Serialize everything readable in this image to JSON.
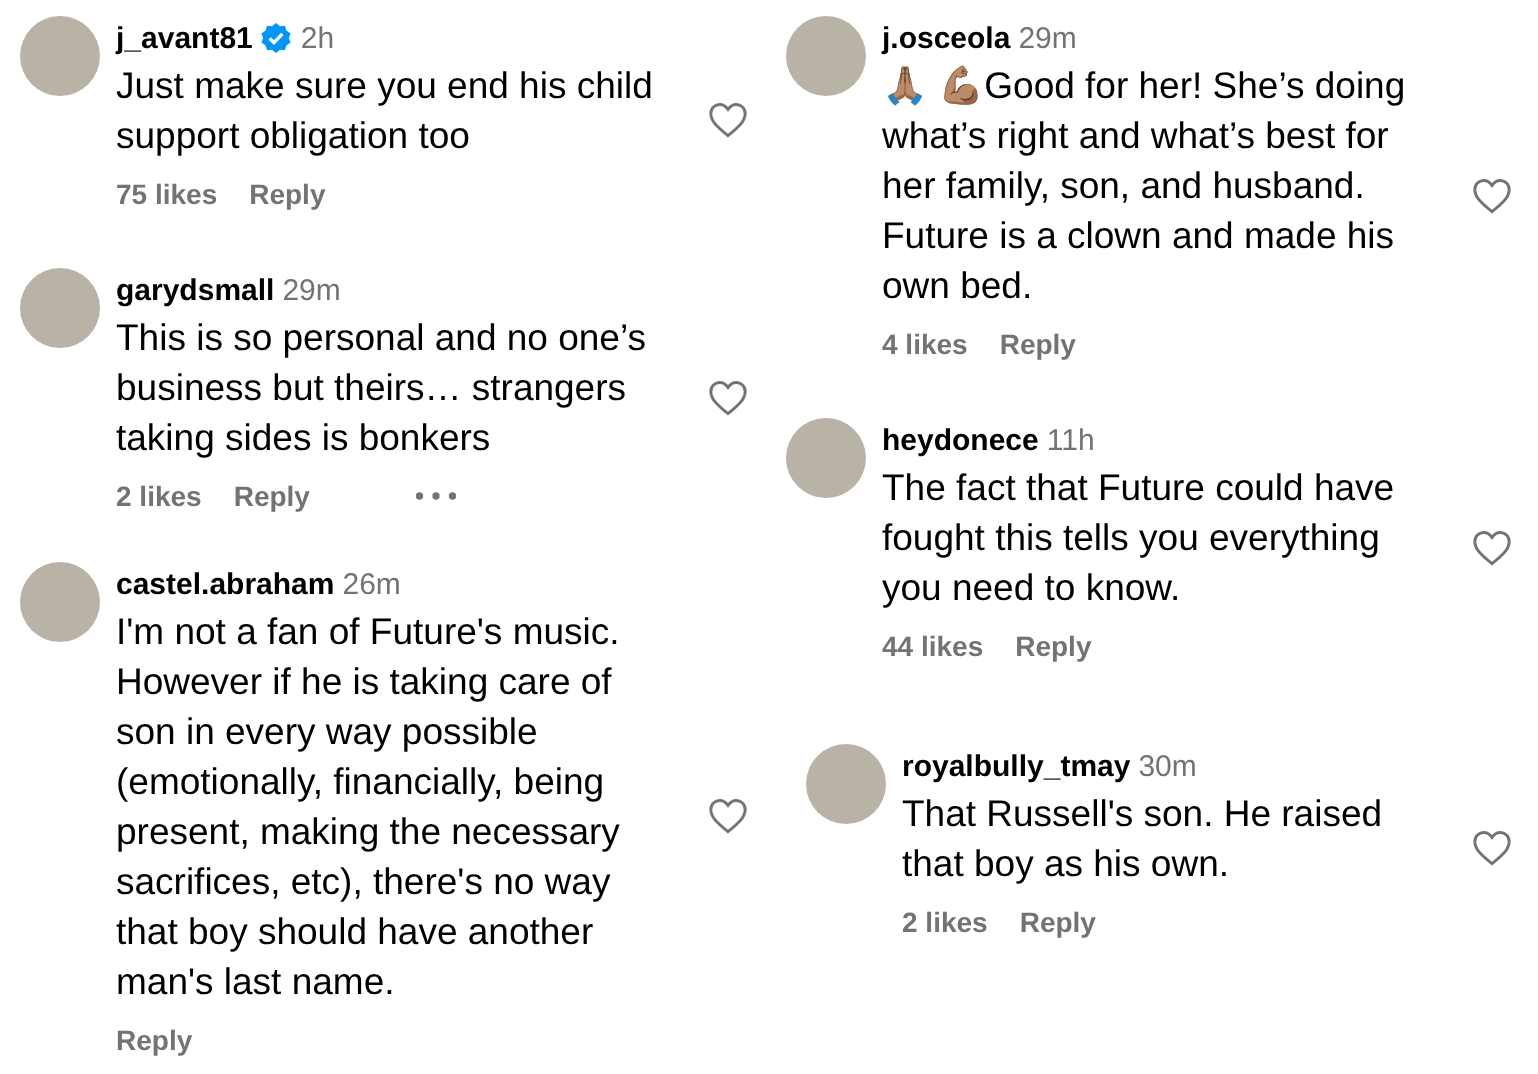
{
  "columns": [
    {
      "comments": [
        {
          "username": "j_avant81",
          "verified": true,
          "time": "2h",
          "text": "Just make sure you end his child support obligation too",
          "likes": "75 likes",
          "reply": "Reply",
          "more": false
        },
        {
          "username": "garydsmall",
          "verified": false,
          "time": "29m",
          "text": "This is so personal and no one’s business but theirs… strangers taking sides is bonkers",
          "likes": "2 likes",
          "reply": "Reply",
          "more": true
        },
        {
          "username": "castel.abraham",
          "verified": false,
          "time": "26m",
          "text": "I'm not a fan of Future's music. However if he is taking care of son in every way possible (emotionally, financially, being present, making the necessary sacrifices, etc), there's no way that boy should have another man's last name.",
          "reply": "Reply",
          "more": false
        }
      ]
    },
    {
      "comments": [
        {
          "username": "j.osceola",
          "verified": false,
          "time": "29m",
          "text": "🙏🏽 💪🏽Good for her! She’s doing what’s right and what’s best for her family, son, and husband. Future is a clown and made his own bed.",
          "likes": "4 likes",
          "reply": "Reply",
          "more": false
        },
        {
          "username": "heydonece",
          "verified": false,
          "time": "11h",
          "text": "The fact that Future could have fought this tells you everything you need to know.",
          "likes": "44 likes",
          "reply": "Reply",
          "more": false
        },
        {
          "username": "royalbully_tmay",
          "verified": false,
          "time": "30m",
          "text": "That Russell's son. He raised that boy as his own.",
          "likes": "2 likes",
          "reply": "Reply",
          "more": false
        }
      ]
    }
  ]
}
